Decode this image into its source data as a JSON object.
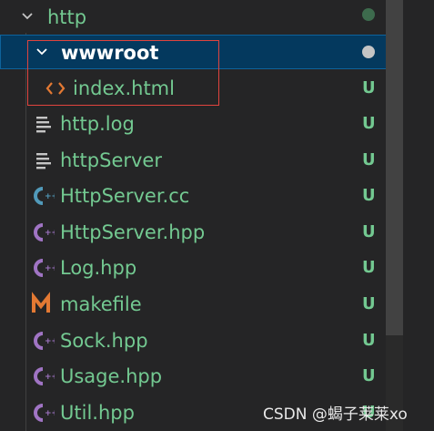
{
  "explorer": {
    "folder_http": {
      "label": "http"
    },
    "folder_wwwroot": {
      "label": "wwwroot"
    },
    "files": [
      {
        "label": "index.html",
        "status": "U",
        "icon": "html-file-icon"
      },
      {
        "label": "http.log",
        "status": "U",
        "icon": "text-file-icon"
      },
      {
        "label": "httpServer",
        "status": "U",
        "icon": "text-file-icon"
      },
      {
        "label": "HttpServer.cc",
        "status": "U",
        "icon": "cpp-source-icon"
      },
      {
        "label": "HttpServer.hpp",
        "status": "U",
        "icon": "cpp-header-icon"
      },
      {
        "label": "Log.hpp",
        "status": "U",
        "icon": "cpp-header-icon"
      },
      {
        "label": "makefile",
        "status": "U",
        "icon": "makefile-icon"
      },
      {
        "label": "Sock.hpp",
        "status": "U",
        "icon": "cpp-header-icon"
      },
      {
        "label": "Usage.hpp",
        "status": "U",
        "icon": "cpp-header-icon"
      },
      {
        "label": "Util.hpp",
        "status": "U",
        "icon": "cpp-header-icon"
      }
    ]
  },
  "colors": {
    "untracked_green": "#73c991",
    "selection_blue": "#04395e",
    "html_orange": "#e37933",
    "cpp_purple": "#a074c4",
    "cpp_source_blue": "#519aba",
    "annotation_red": "#e0443e"
  },
  "watermark": {
    "text": "CSDN @蝎子莱莱xo"
  }
}
